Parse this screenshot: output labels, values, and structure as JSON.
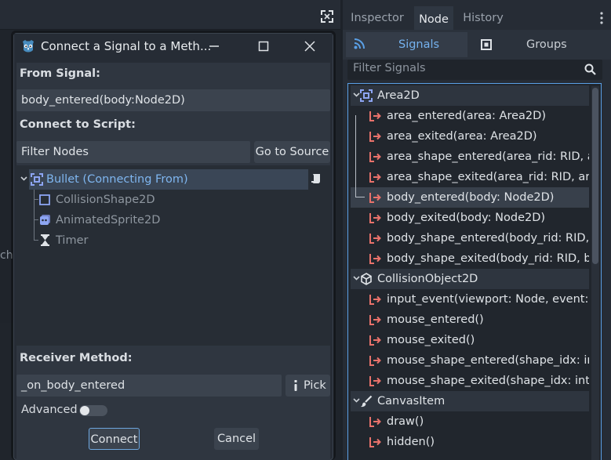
{
  "dock": {
    "tabs": [
      "Inspector",
      "Node",
      "History"
    ],
    "active_tab": "Node",
    "subtabs": {
      "signals": "Signals",
      "groups": "Groups"
    },
    "filter_placeholder": "Filter Signals",
    "categories": [
      {
        "name": "Area2D",
        "signals": [
          "area_entered(area: Area2D)",
          "area_exited(area: Area2D)",
          "area_shape_entered(area_rid: RID, ar...",
          "area_shape_exited(area_rid: RID, area...",
          "body_entered(body: Node2D)",
          "body_exited(body: Node2D)",
          "body_shape_entered(body_rid: RID, b...",
          "body_shape_exited(body_rid: RID, bo..."
        ]
      },
      {
        "name": "CollisionObject2D",
        "signals": [
          "input_event(viewport: Node, event: In...",
          "mouse_entered()",
          "mouse_exited()",
          "mouse_shape_entered(shape_idx: int)",
          "mouse_shape_exited(shape_idx: int)"
        ]
      },
      {
        "name": "CanvasItem",
        "signals": [
          "draw()",
          "hidden()"
        ]
      }
    ],
    "selected_signal": "body_entered(body: Node2D)"
  },
  "editor": {
    "edge_text": "ch"
  },
  "dialog": {
    "title": "Connect a Signal to a Meth...",
    "from_signal_label": "From Signal:",
    "from_signal_value": "body_entered(body:Node2D)",
    "connect_to_label": "Connect to Script:",
    "filter_nodes_placeholder": "Filter Nodes",
    "go_to_source": "Go to Source",
    "nodes": [
      {
        "name": "Bullet (Connecting From)",
        "icon": "area2d-icon"
      },
      {
        "name": "CollisionShape2D",
        "icon": "collision-shape-icon"
      },
      {
        "name": "AnimatedSprite2D",
        "icon": "animated-sprite-icon"
      },
      {
        "name": "Timer",
        "icon": "timer-icon"
      }
    ],
    "receiver_label": "Receiver Method:",
    "receiver_value": "_on_body_entered",
    "pick_label": "Pick",
    "advanced_label": "Advanced",
    "advanced_on": false,
    "connect_label": "Connect",
    "cancel_label": "Cancel"
  },
  "colors": {
    "accent": "#5aa0e6",
    "signal_icon": "#e9726b",
    "node_green": "#8da5f3"
  }
}
